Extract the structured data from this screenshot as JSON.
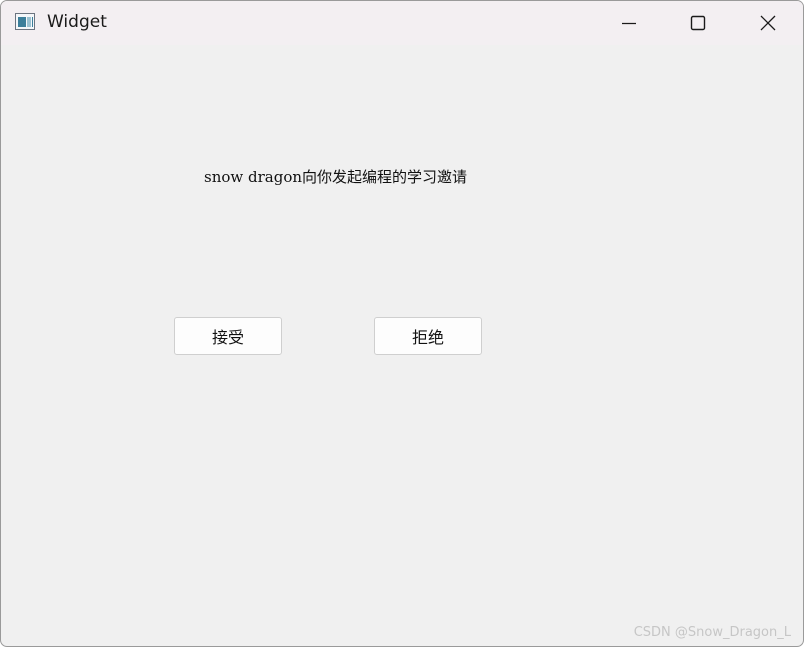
{
  "window": {
    "title": "Widget",
    "app_icon": "widget-app-icon",
    "controls": {
      "minimize_icon": "minimize-icon",
      "maximize_icon": "maximize-icon",
      "close_icon": "close-icon"
    }
  },
  "content": {
    "message": "snow dragon向你发起编程的学习邀请",
    "accept_label": "接受",
    "reject_label": "拒绝"
  },
  "watermark": {
    "text": "CSDN @Snow_Dragon_L"
  },
  "colors": {
    "window_background": "#f0f0f0",
    "titlebar_background": "#f3eff2",
    "button_background": "#fdfdfd",
    "button_border": "#cfcfcf",
    "watermark_text": "#c6c6c6"
  }
}
